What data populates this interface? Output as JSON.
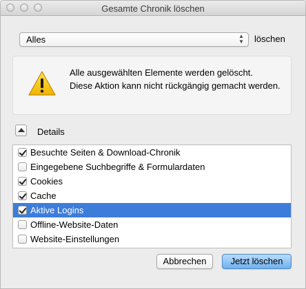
{
  "window": {
    "title": "Gesamte Chronik löschen"
  },
  "timerange": {
    "selected": "Alles",
    "suffix": "löschen"
  },
  "notice": {
    "line1": "Alle ausgewählten Elemente werden gelöscht.",
    "line2": "Diese Aktion kann nicht rückgängig gemacht werden.",
    "icon": "warning-icon",
    "icon_color": "#f5c30a"
  },
  "details": {
    "label": "Details",
    "items": [
      {
        "label": "Besuchte Seiten & Download-Chronik",
        "checked": true,
        "selected": false
      },
      {
        "label": "Eingegebene Suchbegriffe & Formulardaten",
        "checked": false,
        "selected": false
      },
      {
        "label": "Cookies",
        "checked": true,
        "selected": false
      },
      {
        "label": "Cache",
        "checked": true,
        "selected": false
      },
      {
        "label": "Aktive Logins",
        "checked": true,
        "selected": true
      },
      {
        "label": "Offline-Website-Daten",
        "checked": false,
        "selected": false
      },
      {
        "label": "Website-Einstellungen",
        "checked": false,
        "selected": false
      }
    ]
  },
  "buttons": {
    "cancel": "Abbrechen",
    "confirm": "Jetzt löschen"
  },
  "colors": {
    "selection": "#3d7dda",
    "primary_button": "#6fb1f0"
  }
}
